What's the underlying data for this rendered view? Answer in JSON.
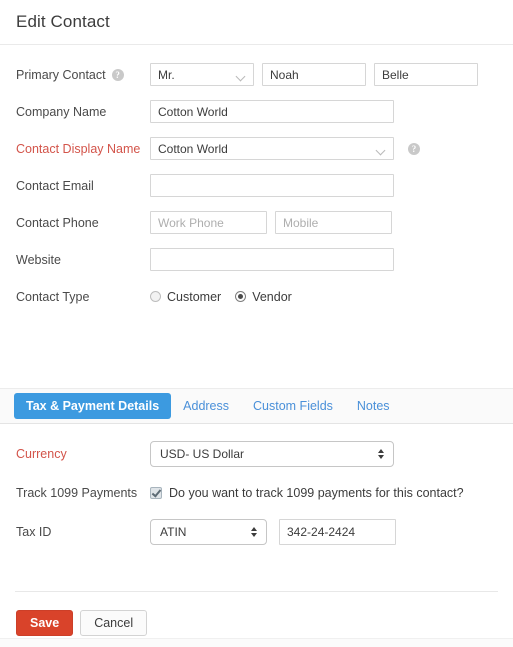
{
  "header": {
    "title": "Edit Contact"
  },
  "form": {
    "primary_contact": {
      "label": "Primary Contact",
      "help_icon": "help-circle-icon",
      "salutation": "Mr.",
      "first_name": "Noah",
      "last_name": "Belle"
    },
    "company_name": {
      "label": "Company Name",
      "value": "Cotton World"
    },
    "contact_display_name": {
      "label": "Contact Display Name",
      "value": "Cotton World",
      "required": true,
      "help_icon": "help-circle-icon"
    },
    "contact_email": {
      "label": "Contact Email",
      "value": ""
    },
    "contact_phone": {
      "label": "Contact Phone",
      "work_placeholder": "Work Phone",
      "mobile_placeholder": "Mobile",
      "work_value": "",
      "mobile_value": ""
    },
    "website": {
      "label": "Website",
      "value": ""
    },
    "contact_type": {
      "label": "Contact Type",
      "options": [
        {
          "label": "Customer",
          "selected": false
        },
        {
          "label": "Vendor",
          "selected": true
        }
      ]
    }
  },
  "tabs": [
    {
      "label": "Tax & Payment Details",
      "active": true
    },
    {
      "label": "Address",
      "active": false
    },
    {
      "label": "Custom Fields",
      "active": false
    },
    {
      "label": "Notes",
      "active": false
    }
  ],
  "tax_panel": {
    "currency": {
      "label": "Currency",
      "value": "USD- US Dollar",
      "required": true
    },
    "track_1099": {
      "label": "Track 1099 Payments",
      "checkbox_label": "Do you want to track 1099 payments for this contact?",
      "checked": true
    },
    "tax_id": {
      "label": "Tax ID",
      "type_value": "ATIN",
      "number_value": "342-24-2424"
    }
  },
  "footer": {
    "save_label": "Save",
    "cancel_label": "Cancel"
  },
  "colors": {
    "accent_blue": "#3c9ae0",
    "link_blue": "#4a90d9",
    "required_red": "#d3544a",
    "save_red": "#d9432a",
    "text": "#3c3c3c",
    "border": "#d6d6d6"
  }
}
